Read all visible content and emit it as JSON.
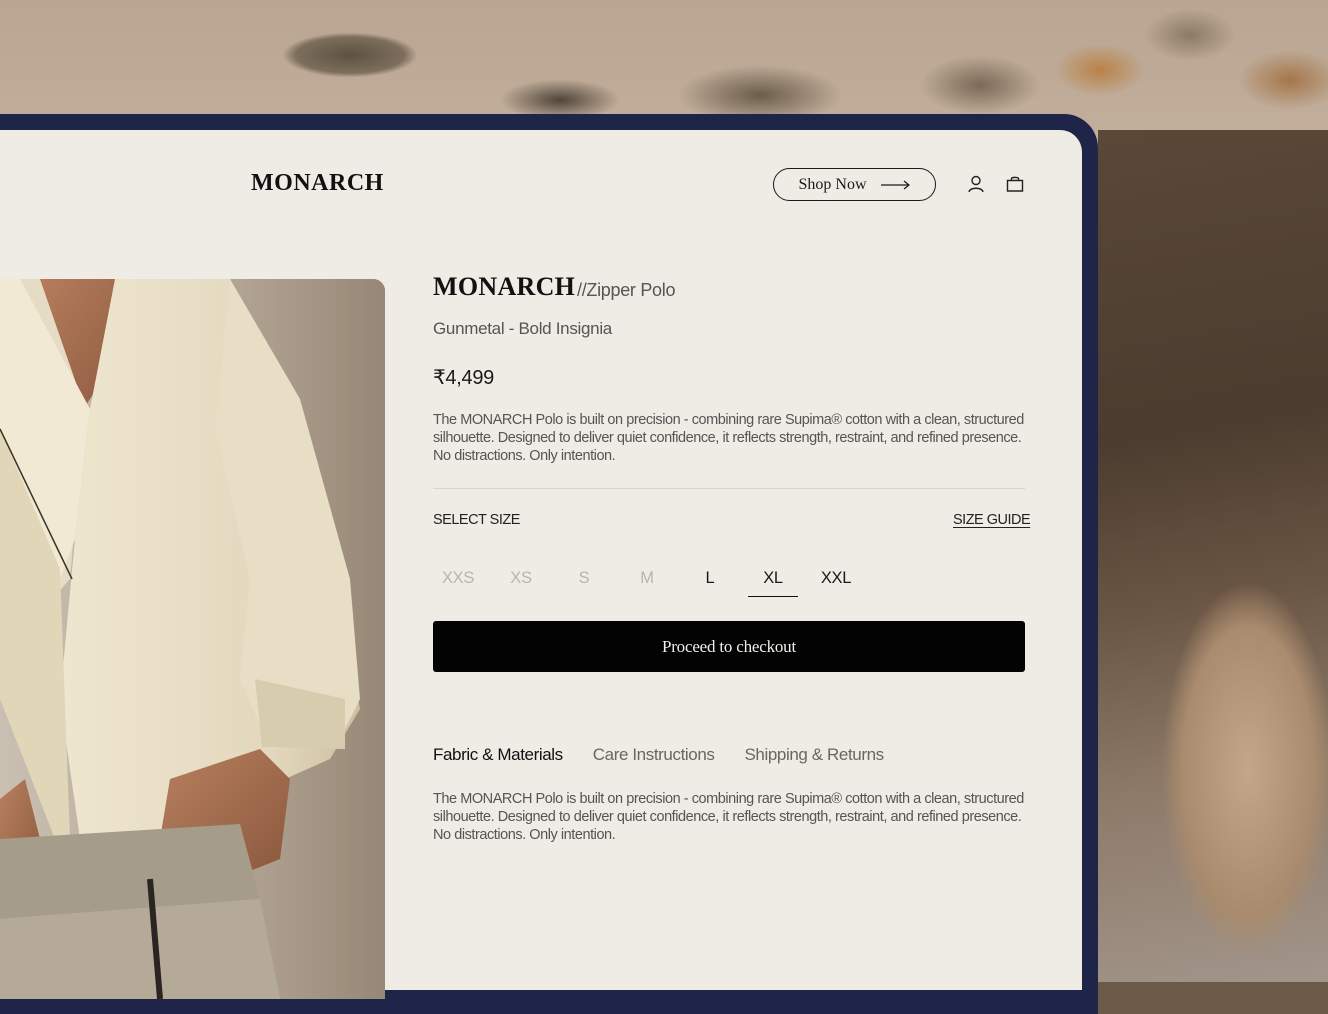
{
  "header": {
    "logo": "MONARCH",
    "shop_now_label": "Shop Now",
    "icons": [
      "user-icon",
      "shopping-bag-icon"
    ]
  },
  "product": {
    "brand": "MONARCH",
    "model": "//Zipper Polo",
    "variant": "Gunmetal - Bold Insignia",
    "price": "₹4,499",
    "description": "The MONARCH Polo is built on precision - combining rare Supima® cotton with a clean, structured silhouette. Designed to deliver quiet confidence, it reflects strength, restraint, and refined presence. No distractions. Only intention."
  },
  "size_selector": {
    "label": "SELECT SIZE",
    "guide_label": "SIZE GUIDE",
    "sizes": [
      {
        "label": "XXS",
        "available": false
      },
      {
        "label": "XS",
        "available": false
      },
      {
        "label": "S",
        "available": false
      },
      {
        "label": "M",
        "available": false
      },
      {
        "label": "L",
        "available": true
      },
      {
        "label": "XL",
        "available": true,
        "selected": true
      },
      {
        "label": "XXL",
        "available": true
      }
    ]
  },
  "checkout_label": "Proceed to checkout",
  "info_tabs": {
    "tabs": [
      "Fabric & Materials",
      "Care Instructions",
      "Shipping & Returns"
    ],
    "active": "Fabric & Materials",
    "content": "The MONARCH Polo is built on precision - combining rare Supima® cotton with a clean, structured silhouette. Designed to deliver quiet confidence, it reflects strength, restraint, and refined presence. No distractions. Only intention."
  },
  "colors": {
    "frame": "#1e2548",
    "panel": "#efebe5",
    "checkout_bg": "#030303"
  }
}
